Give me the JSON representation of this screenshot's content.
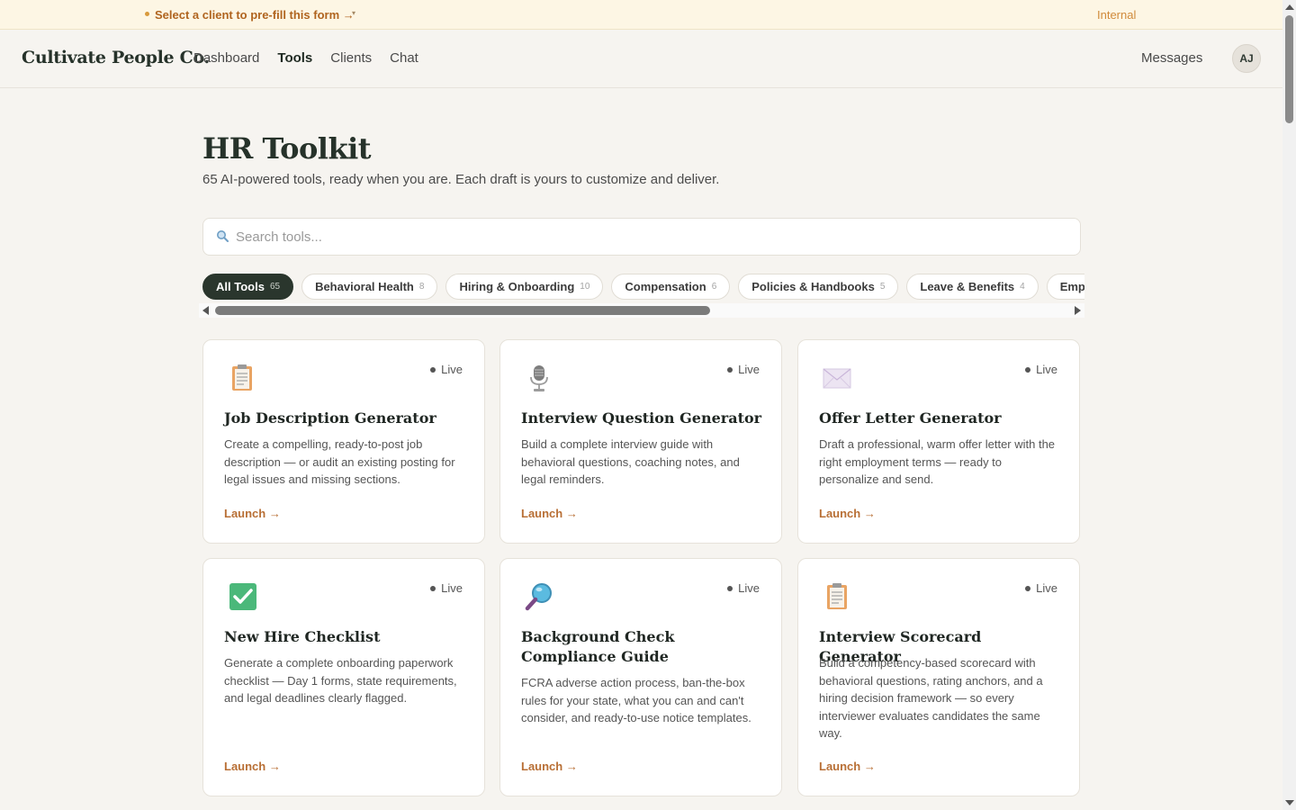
{
  "banner": {
    "select_client_label": "Select a client to pre-fill this form →",
    "caret": "▾",
    "internal_label": "Internal",
    "dot_color": "#d89a3c"
  },
  "header": {
    "logo": "Cultivate People Co.",
    "nav": [
      {
        "label": "Dashboard",
        "active": false
      },
      {
        "label": "Tools",
        "active": true
      },
      {
        "label": "Clients",
        "active": false
      },
      {
        "label": "Chat",
        "active": false
      }
    ],
    "messages_label": "Messages",
    "avatar_initials": "AJ"
  },
  "main": {
    "title": "HR Toolkit",
    "subtitle": "65 AI-powered tools, ready when you are. Each draft is yours to customize and deliver.",
    "search": {
      "placeholder": "Search tools...",
      "value": "",
      "icon": "search-icon"
    },
    "filters": [
      {
        "label": "All Tools",
        "count": "65",
        "active": true
      },
      {
        "label": "Behavioral Health",
        "count": "8",
        "active": false
      },
      {
        "label": "Hiring & Onboarding",
        "count": "10",
        "active": false
      },
      {
        "label": "Compensation",
        "count": "6",
        "active": false
      },
      {
        "label": "Policies & Handbooks",
        "count": "5",
        "active": false
      },
      {
        "label": "Leave & Benefits",
        "count": "4",
        "active": false
      },
      {
        "label": "Employee Relations",
        "count": "",
        "active": false
      }
    ],
    "cards": [
      {
        "icon": "clipboard-icon",
        "status": "Live",
        "title": "Job Description Generator",
        "description": "Create a compelling, ready-to-post job description — or audit an existing posting for legal issues and missing sections.",
        "launch_label": "Launch →"
      },
      {
        "icon": "microphone-icon",
        "status": "Live",
        "title": "Interview Question Generator",
        "description": "Build a complete interview guide with behavioral questions, coaching notes, and legal reminders.",
        "launch_label": "Launch →"
      },
      {
        "icon": "envelope-icon",
        "status": "Live",
        "title": "Offer Letter Generator",
        "description": "Draft a professional, warm offer letter with the right employment terms — ready to personalize and send.",
        "launch_label": "Launch →"
      },
      {
        "icon": "checkmark-icon",
        "status": "Live",
        "title": "New Hire Checklist",
        "description": "Generate a complete onboarding paperwork checklist — Day 1 forms, state requirements, and legal deadlines clearly flagged.",
        "launch_label": "Launch →"
      },
      {
        "icon": "magnifier-icon",
        "status": "Live",
        "title": "Background Check Compliance Guide",
        "description": "FCRA adverse action process, ban-the-box rules for your state, what you can and can't consider, and ready-to-use notice templates.",
        "launch_label": "Launch →"
      },
      {
        "icon": "clipboard-icon",
        "status": "Live",
        "title": "Interview Scorecard Generator",
        "description": "Build a competency-based scorecard with behavioral questions, rating anchors, and a hiring decision framework — so every interviewer evaluates candidates the same way.",
        "launch_label": "Launch →"
      }
    ]
  },
  "colors": {
    "background": "#f6f4f0",
    "accent": "#b86f35",
    "active_chip": "#2a362d",
    "heading": "#26322a"
  }
}
